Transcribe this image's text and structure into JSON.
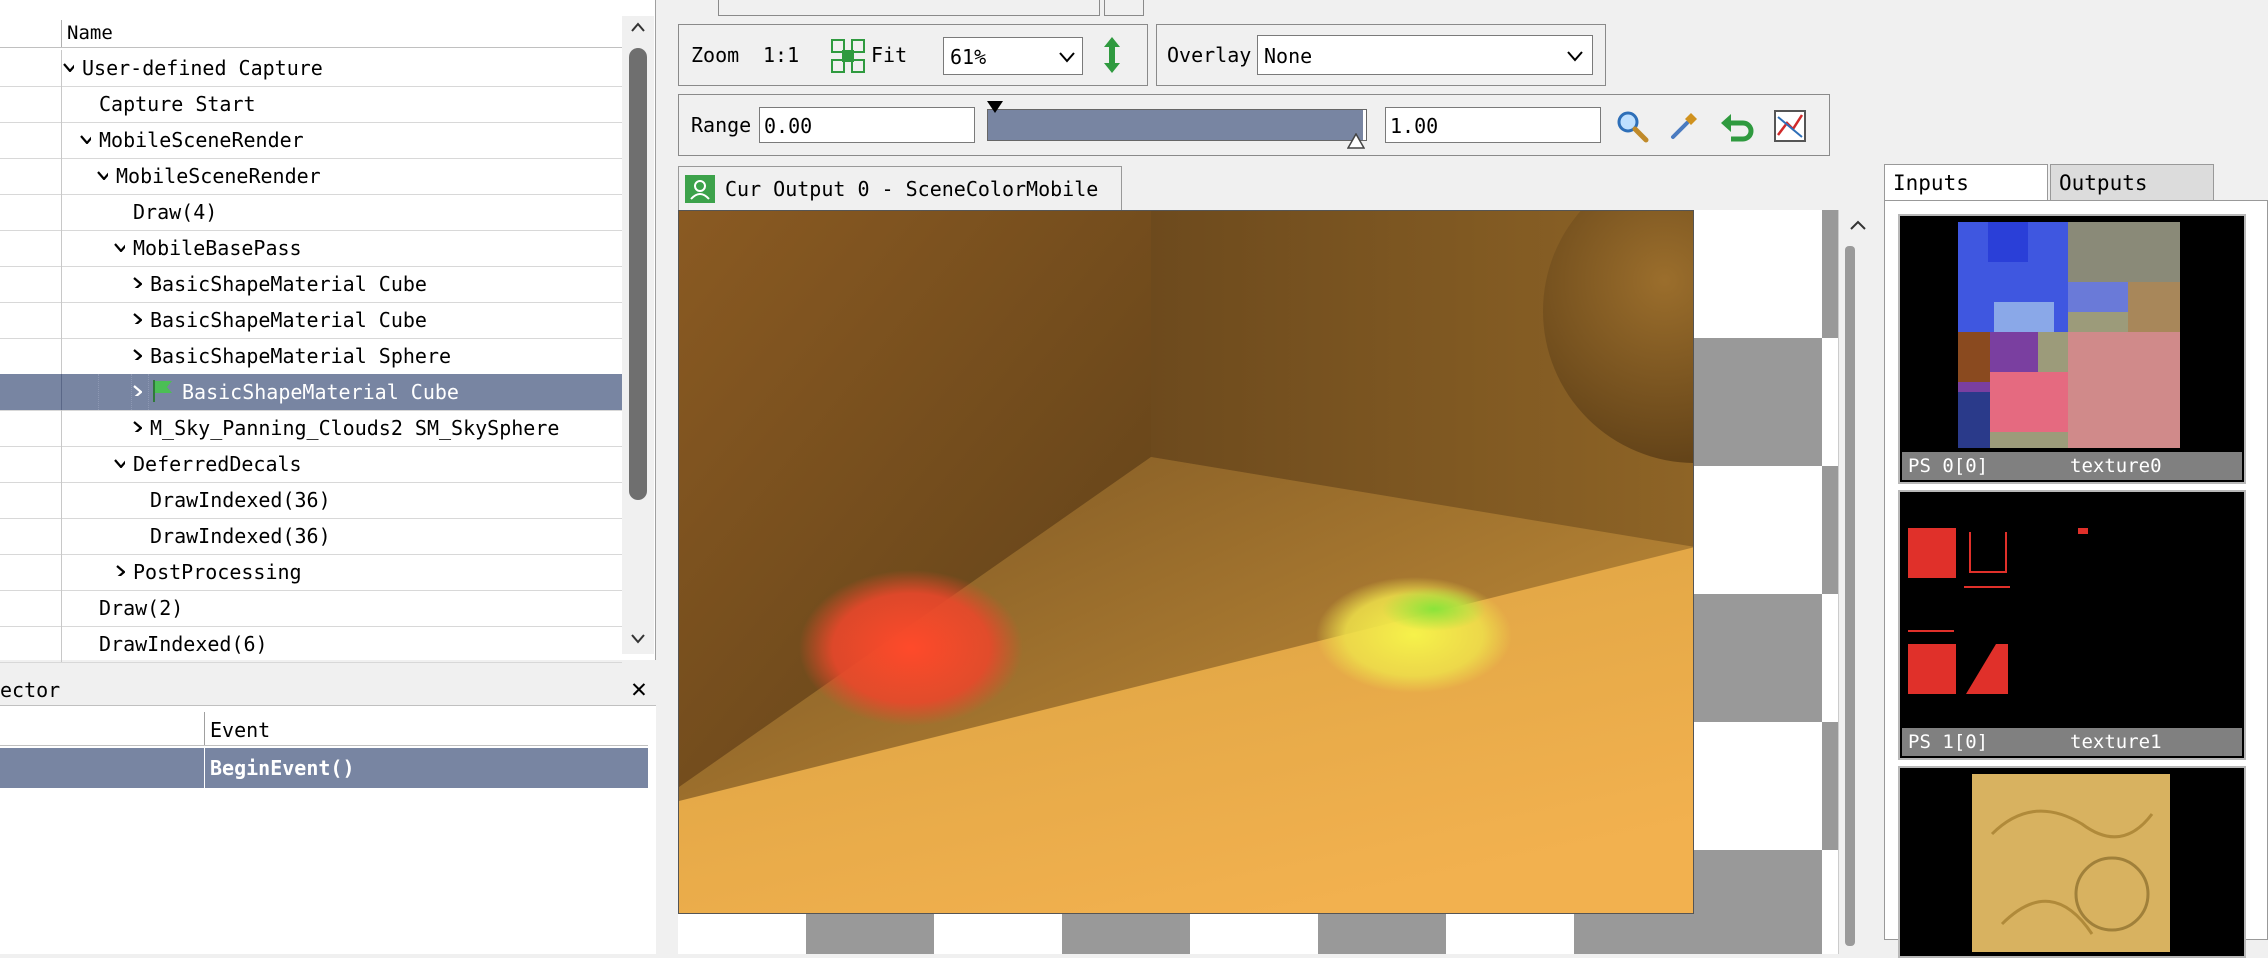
{
  "event_browser": {
    "column_name": "Name",
    "rows": [
      {
        "label": "User-defined Capture",
        "expanded": true
      },
      {
        "label": "Capture Start"
      },
      {
        "label": "MobileSceneRender",
        "expanded": true
      },
      {
        "label": "MobileSceneRender",
        "expanded": true
      },
      {
        "label": "Draw(4)"
      },
      {
        "label": "MobileBasePass",
        "expanded": true
      },
      {
        "label": "BasicShapeMaterial Cube",
        "expanded": false
      },
      {
        "label": "BasicShapeMaterial Cube",
        "expanded": false
      },
      {
        "label": "BasicShapeMaterial Sphere",
        "expanded": false
      },
      {
        "label": "BasicShapeMaterial Cube",
        "expanded": false,
        "selected": true,
        "bookmark": true
      },
      {
        "label": "M_Sky_Panning_Clouds2 SM_SkySphere",
        "expanded": false
      },
      {
        "label": "DeferredDecals",
        "expanded": true
      },
      {
        "label": "DrawIndexed(36)"
      },
      {
        "label": "DrawIndexed(36)"
      },
      {
        "label": "PostProcessing",
        "expanded": false
      },
      {
        "label": "Draw(2)"
      },
      {
        "label": "DrawIndexed(6)"
      }
    ]
  },
  "inspector": {
    "title": "ector",
    "column_event": "Event",
    "row_event": "BeginEvent()"
  },
  "toolbar": {
    "zoom_label": "Zoom",
    "one_to_one": "1:1",
    "fit_label": "Fit",
    "zoom_value": "61%",
    "overlay_label": "Overlay",
    "overlay_value": "None",
    "range_label": "Range",
    "range_min": "0.00",
    "range_max": "1.00",
    "range_fraction": [
      0.0,
      1.0
    ]
  },
  "viewer": {
    "tab_title": "Cur Output 0 - SceneColorMobile"
  },
  "io_panel": {
    "tab_inputs": "Inputs",
    "tab_outputs": "Outputs",
    "thumbnails": [
      {
        "slot": "PS 0[0]",
        "name": "texture0"
      },
      {
        "slot": "PS 1[0]",
        "name": "texture1"
      },
      {
        "slot": "",
        "name": ""
      }
    ]
  },
  "colors": {
    "selection": "#7885a2",
    "accent_green": "#3ca24a"
  }
}
